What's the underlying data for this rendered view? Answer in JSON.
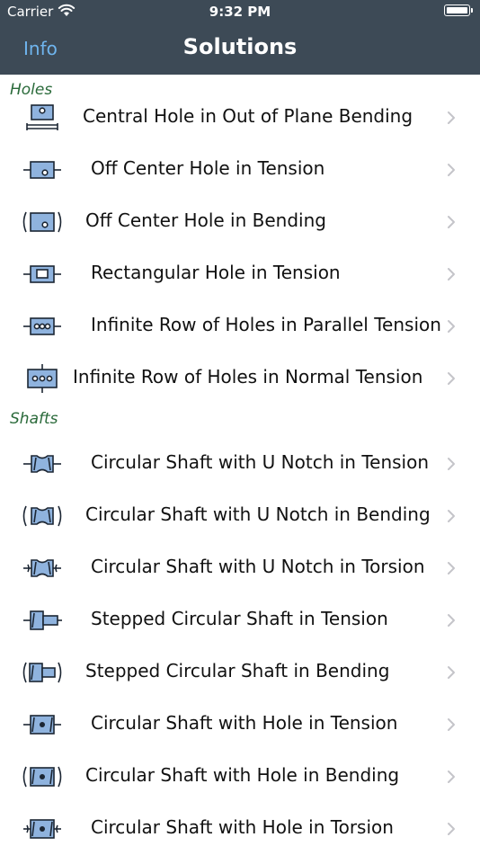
{
  "status": {
    "carrier": "Carrier",
    "time": "9:32 PM"
  },
  "nav": {
    "back_label": "Info",
    "title": "Solutions"
  },
  "sections": [
    {
      "header": "Holes",
      "items": [
        {
          "label": "Central Hole in Out of Plane Bending",
          "icon": "central-hole-bending-icon"
        },
        {
          "label": "Off Center Hole in Tension",
          "icon": "off-center-hole-tension-icon"
        },
        {
          "label": "Off Center Hole in Bending",
          "icon": "off-center-hole-bending-icon"
        },
        {
          "label": "Rectangular Hole in Tension",
          "icon": "rectangular-hole-tension-icon"
        },
        {
          "label": "Infinite Row of Holes in Parallel Tension",
          "icon": "row-holes-parallel-tension-icon"
        },
        {
          "label": "Infinite Row of Holes in Normal Tension",
          "icon": "row-holes-normal-tension-icon"
        }
      ]
    },
    {
      "header": "Shafts",
      "items": [
        {
          "label": "Circular Shaft with U Notch in Tension",
          "icon": "shaft-u-notch-tension-icon"
        },
        {
          "label": "Circular Shaft with U Notch in Bending",
          "icon": "shaft-u-notch-bending-icon"
        },
        {
          "label": "Circular Shaft with U Notch in Torsion",
          "icon": "shaft-u-notch-torsion-icon"
        },
        {
          "label": "Stepped Circular Shaft in Tension",
          "icon": "stepped-shaft-tension-icon"
        },
        {
          "label": "Stepped Circular Shaft in Bending",
          "icon": "stepped-shaft-bending-icon"
        },
        {
          "label": "Circular Shaft with Hole in Tension",
          "icon": "shaft-hole-tension-icon"
        },
        {
          "label": "Circular Shaft with Hole in Bending",
          "icon": "shaft-hole-bending-icon"
        },
        {
          "label": "Circular Shaft with Hole in Torsion",
          "icon": "shaft-hole-torsion-icon"
        }
      ]
    }
  ],
  "colors": {
    "nav_bg": "#3d4a56",
    "accent": "#6fb5ee",
    "section_header": "#2a6a3a",
    "icon_fill": "#8fb3de"
  }
}
